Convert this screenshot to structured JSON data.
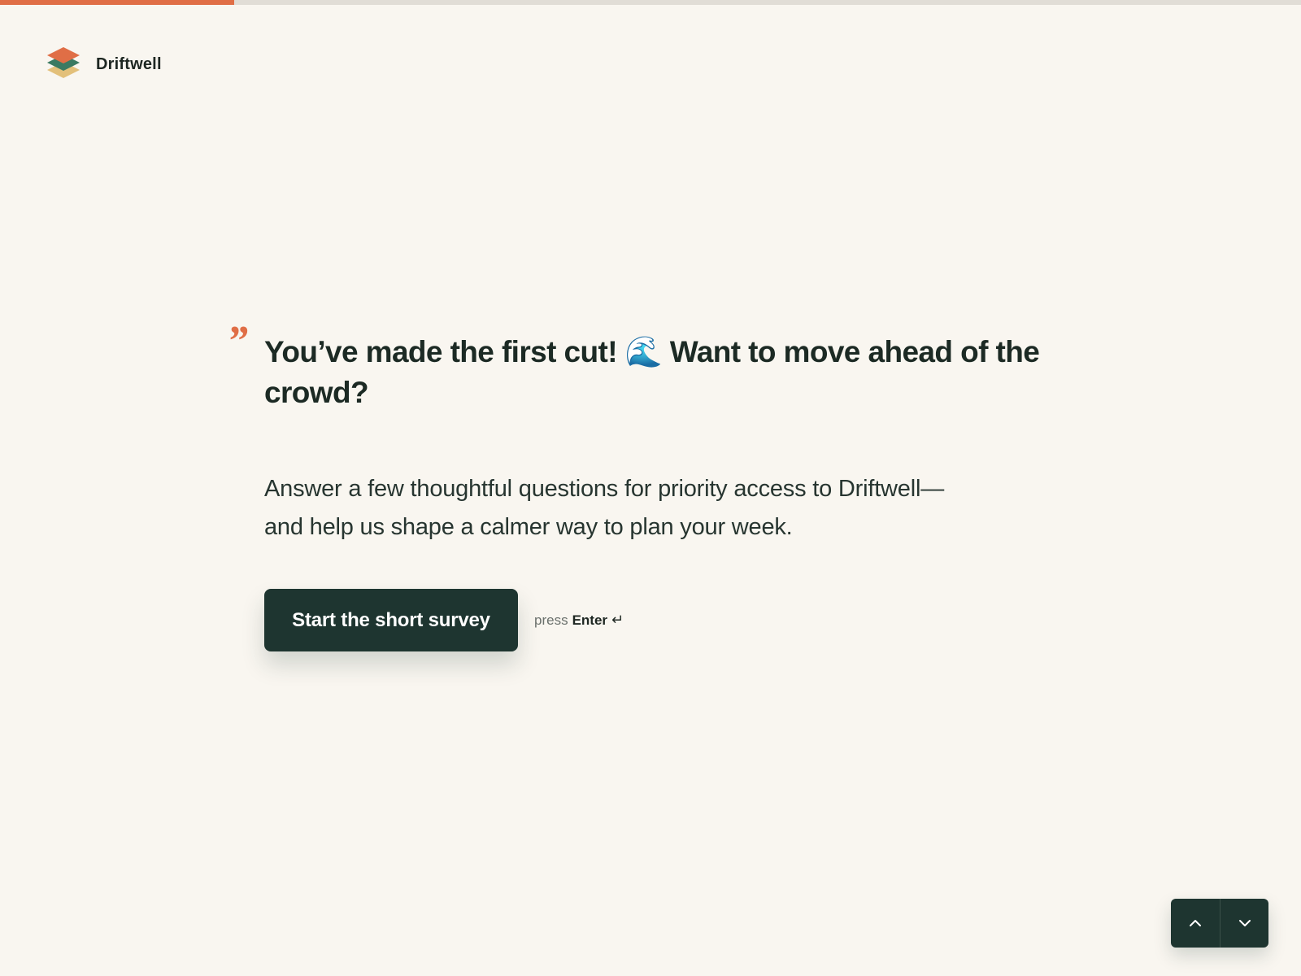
{
  "progress": {
    "fraction": 0.18
  },
  "brand": {
    "name": "Driftwell",
    "logo_icon": "layered-diamond-logo"
  },
  "quote_mark": "”",
  "headline": "You’ve made the first cut! 🌊 Want to move ahead of the crowd?",
  "subtext": "Answer a few thoughtful questions for priority access to Driftwell—and help us shape a calmer way to plan your week.",
  "cta": {
    "label": "Start the short survey",
    "hint_prefix": "press",
    "hint_key": "Enter",
    "hint_symbol": "↵"
  },
  "nav": {
    "up_icon": "chevron-up-icon",
    "down_icon": "chevron-down-icon"
  },
  "colors": {
    "background": "#f9f6f0",
    "accent": "#e06e46",
    "primary": "#1e3530",
    "text": "#1c2a24"
  }
}
